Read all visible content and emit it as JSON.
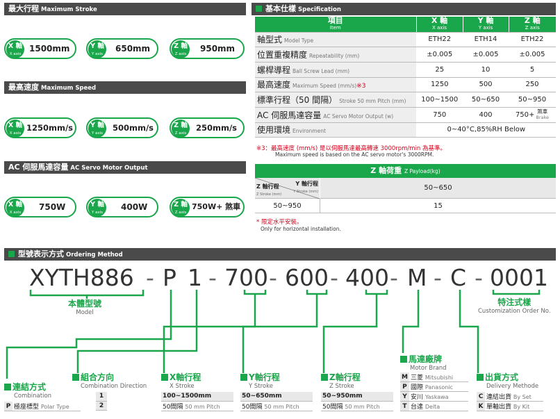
{
  "left_sections": [
    {
      "title": "最大行程",
      "title_en": "Maximum Stroke",
      "items": [
        {
          "axis": "X 軸",
          "axis_en": "X axis",
          "value": "1500mm"
        },
        {
          "axis": "Y 軸",
          "axis_en": "Y axis",
          "value": "650mm"
        },
        {
          "axis": "Z 軸",
          "axis_en": "Z axis",
          "value": "950mm"
        }
      ]
    },
    {
      "title": "最高速度",
      "title_en": "Maximum Speed",
      "items": [
        {
          "axis": "X 軸",
          "axis_en": "X axis",
          "value": "1250mm/s"
        },
        {
          "axis": "Y 軸",
          "axis_en": "Y axis",
          "value": "500mm/s"
        },
        {
          "axis": "Z 軸",
          "axis_en": "Z axis",
          "value": "250mm/s"
        }
      ]
    },
    {
      "title": "AC 伺服馬達容量",
      "title_en": "AC Servo Motor Output",
      "items": [
        {
          "axis": "X 軸",
          "axis_en": "X axis",
          "value": "750W"
        },
        {
          "axis": "Y 軸",
          "axis_en": "Y axis",
          "value": "400W"
        },
        {
          "axis": "Z 軸",
          "axis_en": "Z axis",
          "value": "750W+ 煞車"
        }
      ]
    }
  ],
  "spec": {
    "title": "基本仕樣",
    "title_en": "Specification",
    "head": {
      "item": "項目",
      "item_en": "Item",
      "x": "X 軸",
      "x_en": "X axis",
      "y": "Y 軸",
      "y_en": "Y axis",
      "z": "Z 軸",
      "z_en": "Z axis"
    },
    "rows": [
      {
        "label": "軸型式",
        "label_en": "Model Type",
        "x": "ETH22",
        "y": "ETH14",
        "z": "ETH22"
      },
      {
        "label": "位置重複精度",
        "label_en": "Repeatability (mm)",
        "x": "±0.005",
        "y": "±0.005",
        "z": "±0.005"
      },
      {
        "label": "螺桿導程",
        "label_en": "Ball Screw Lead (mm)",
        "x": "25",
        "y": "10",
        "z": "5"
      },
      {
        "label": "最高速度",
        "label_en": "Maximum Speed (mm/s)",
        "mark": "※3",
        "x": "1250",
        "y": "500",
        "z": "250"
      },
      {
        "label": "標準行程（50 間隔）",
        "label_en": "Stroke 50 mm Pitch (mm)",
        "x": "100~1500",
        "y": "50~650",
        "z": "50~950"
      },
      {
        "label": "AC 伺服馬達容量",
        "label_en": "AC Servo Motor Output (w)",
        "x": "750",
        "y": "400",
        "z": "750+",
        "z_brake": "煞車",
        "z_brake_en": "Brake"
      }
    ],
    "env": {
      "label": "使用環境",
      "label_en": "Environment",
      "value": "0~40°C,85%RH Below"
    },
    "note_zh": "※3：最高速度 (mm/s) 是以伺服馬達最高轉速 3000rpm/min 為基準。",
    "note_en": "Maximum speed is based on the AC servo motor's 3000RPM."
  },
  "payload": {
    "title": "Z 軸荷重",
    "title_en": "Z Payload(kg)",
    "y_label": "Y 軸行程",
    "y_label_en": "Y Stroke (mm)",
    "z_label": "Z 軸行程",
    "z_label_en": "Z Stroke (mm)",
    "col": "50~650",
    "row": "50~950",
    "value": "15",
    "note_zh": "* 限定水平安裝。",
    "note_en": "Only for horizontal installation."
  },
  "ordering": {
    "title": "型號表示方式",
    "title_en": "Ordering Method",
    "segments": [
      "XYTH886",
      "-",
      "P",
      "1",
      "-",
      "700",
      "-",
      "600",
      "-",
      "400",
      "-",
      "M",
      "-",
      "C",
      "-",
      "0001"
    ],
    "model": "本體型號",
    "model_en": "Model",
    "custom": "特注式樣",
    "custom_en": "Customization Order No.",
    "combination": {
      "title": "連結方式",
      "title_en": "Combination",
      "row_k": "P",
      "row_v": "極座標型",
      "row_e": "Polar Type"
    },
    "direction": {
      "title": "組合方向",
      "title_en": "Combination Direction",
      "rows": [
        "1",
        "2"
      ]
    },
    "xs": {
      "title": "X軸行程",
      "title_en": "X Stroke",
      "range": "100~1500mm",
      "pitch": "50間隔",
      "pitch_en": "50 mm Pitch"
    },
    "ys": {
      "title": "Y軸行程",
      "title_en": "Y Stroke",
      "range": "50~650mm",
      "pitch": "50間隔",
      "pitch_en": "50 mm Pitch"
    },
    "zs": {
      "title": "Z軸行程",
      "title_en": "Z Stroke",
      "range": "50~950mm",
      "pitch": "50間隔",
      "pitch_en": "50 mm Pitch"
    },
    "brand": {
      "title": "馬達廠牌",
      "title_en": "Motor Brand",
      "rows": [
        {
          "k": "M",
          "v": "三菱",
          "e": "Mitsubishi"
        },
        {
          "k": "P",
          "v": "國際",
          "e": "Panasonic"
        },
        {
          "k": "Y",
          "v": "安川",
          "e": "Yaskawa"
        },
        {
          "k": "T",
          "v": "台達",
          "e": "Delta"
        }
      ]
    },
    "delivery": {
      "title": "出貨方式",
      "title_en": "Delivery Methode",
      "rows": [
        {
          "k": "C",
          "v": "連結出貨",
          "e": "By Set"
        },
        {
          "k": "K",
          "v": "單軸出貨",
          "e": "By Kit"
        }
      ]
    }
  },
  "colors": {
    "green": "#1aa64a",
    "dark": "#4a4a4a"
  }
}
